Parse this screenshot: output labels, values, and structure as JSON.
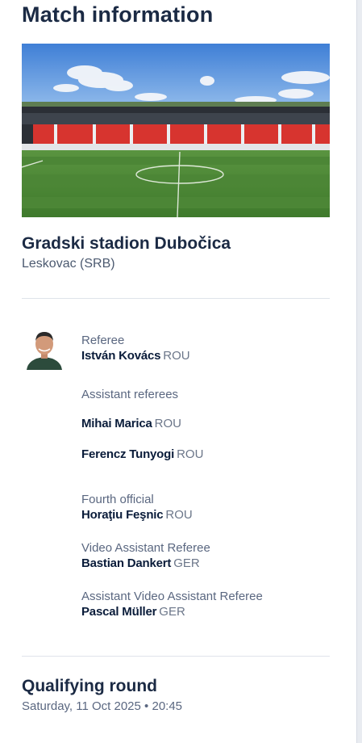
{
  "page": {
    "title": "Match information"
  },
  "venue": {
    "name": "Gradski stadion Dubočica",
    "city": "Leskovac (SRB)"
  },
  "officials": {
    "referee": {
      "role": "Referee",
      "name": "István Kovács",
      "country": "ROU"
    },
    "assistant_referees": {
      "role": "Assistant referees",
      "people": [
        {
          "name": "Mihai Marica",
          "country": "ROU"
        },
        {
          "name": "Ferencz Tunyogi",
          "country": "ROU"
        }
      ]
    },
    "fourth_official": {
      "role": "Fourth official",
      "name": "Horaţiu Feşnic",
      "country": "ROU"
    },
    "var": {
      "role": "Video Assistant Referee",
      "name": "Bastian Dankert",
      "country": "GER"
    },
    "avar": {
      "role": "Assistant Video Assistant Referee",
      "name": "Pascal Müller",
      "country": "GER"
    }
  },
  "round": {
    "title": "Qualifying round",
    "date": "Saturday, 11 Oct 2025",
    "separator": "•",
    "time": "20:45"
  },
  "colors": {
    "title_text": "#1b2a44",
    "body_text": "#0a1c3a",
    "muted_text": "#5a6780",
    "divider": "#dfe3ea",
    "seat_red": "#d7342f",
    "pitch_green": "#4f8a3a"
  }
}
